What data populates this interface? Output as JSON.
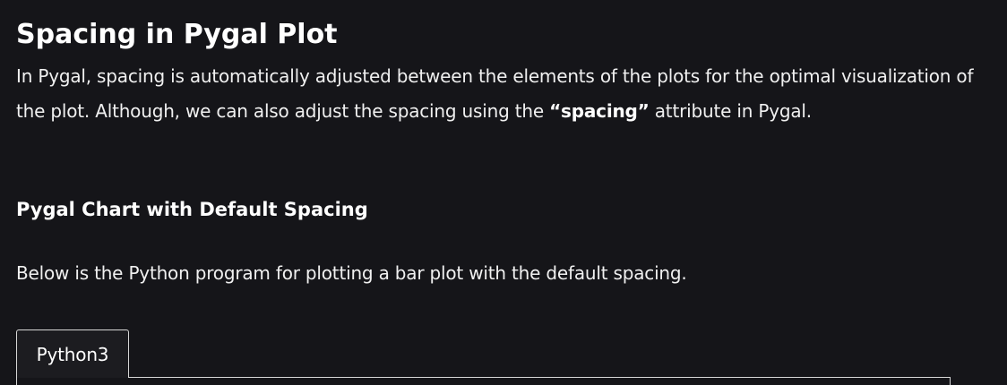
{
  "article": {
    "title": "Spacing in Pygal Plot",
    "intro_before": "In Pygal, spacing is automatically adjusted between the elements of the plots for the optimal visualization of the plot. Although, we can also adjust the spacing using the ",
    "intro_bold": "“spacing”",
    "intro_after": " attribute in Pygal.",
    "subheading": "Pygal Chart with Default Spacing",
    "description": "Below is the Python program for plotting a bar plot with the default spacing."
  },
  "code_block": {
    "tabs": [
      "Python3"
    ]
  },
  "colors": {
    "background": "#151519",
    "text": "#f0f0f0",
    "heading": "#ffffff",
    "tab_border": "#d6d6d6"
  }
}
